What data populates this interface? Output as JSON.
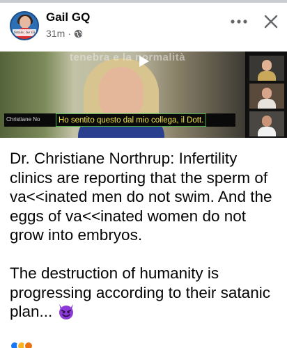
{
  "post": {
    "author": "Gail GQ",
    "timestamp": "31m",
    "separator": "·",
    "privacy_icon": "globe-icon",
    "more_icon": "more-horizontal-icon",
    "close_icon": "close-icon",
    "avatar_caption": "Smile, be Gi"
  },
  "video": {
    "watermark": "tenebra e la normalità",
    "subtitle_name": "Christiane No",
    "subtitle_text": "Ho sentito questo dal mio collega, il Dott.",
    "play_icon": "play-icon"
  },
  "body": {
    "text": "Dr. Christiane Northrup: Infertility clinics are reporting that the sperm of va<<inated men do not swim. And the eggs of va<<inated women do not grow into embryos.\n\nThe destruction of humanity is progressing according to their satanic plan... ",
    "emoji": "smiling-devil-emoji"
  },
  "colors": {
    "text": "#050505",
    "secondary": "#65676b",
    "subtitle_yellow": "#f2e64a",
    "subtitle_border": "#4ab14a",
    "devil_purple": "#8c3bd8"
  }
}
